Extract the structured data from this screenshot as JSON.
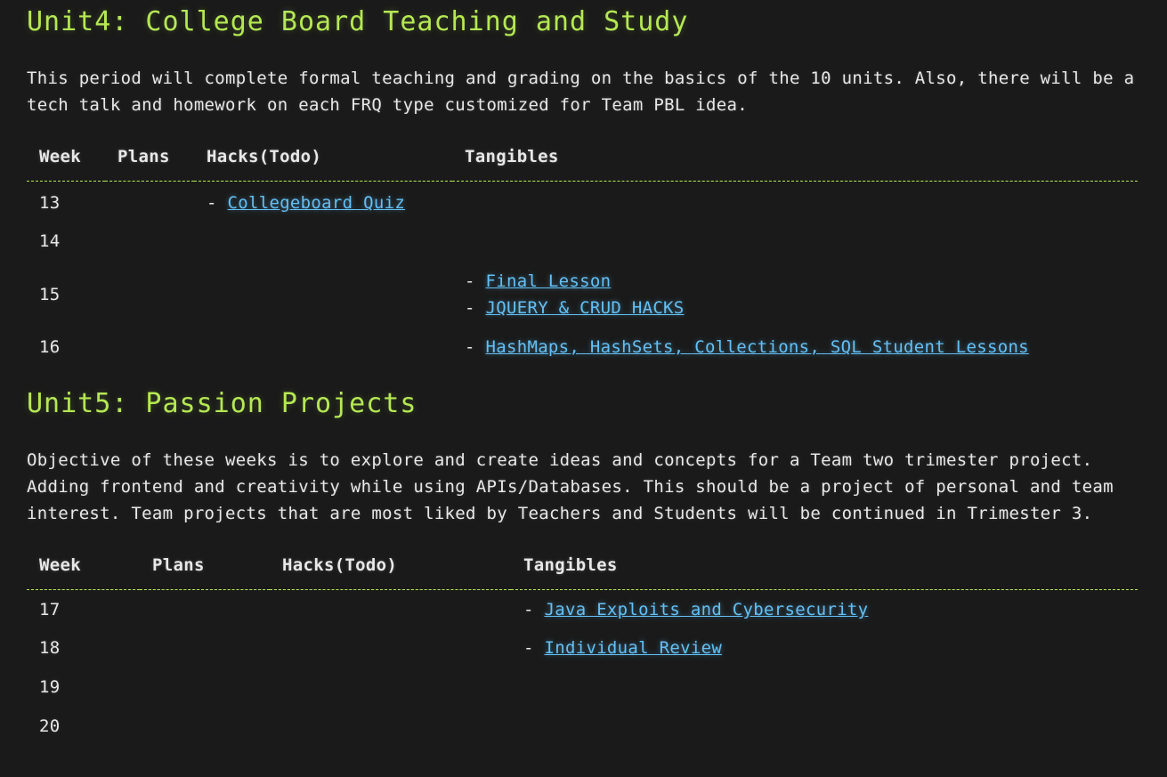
{
  "unit4": {
    "title": "Unit4: College Board Teaching and Study",
    "description": "This period will complete formal teaching and grading on the basics of the 10 units. Also, there will be a tech talk and homework on each FRQ type customized for Team PBL idea.",
    "headers": {
      "week": "Week",
      "plans": "Plans",
      "hacks": "Hacks(Todo)",
      "tangibles": "Tangibles"
    },
    "rows": [
      {
        "week": "13",
        "hacks": [
          {
            "dash": "-",
            "link": "Collegeboard Quiz"
          }
        ],
        "tangibles": []
      },
      {
        "week": "14",
        "hacks": [],
        "tangibles": []
      },
      {
        "week": "15",
        "hacks": [],
        "tangibles": [
          {
            "dash": "-",
            "link": "Final Lesson"
          },
          {
            "dash": "-",
            "link": "JQUERY & CRUD HACKS"
          }
        ]
      },
      {
        "week": "16",
        "hacks": [],
        "tangibles": [
          {
            "dash": "-",
            "link": "HashMaps, HashSets, Collections, SQL Student Lessons"
          }
        ]
      }
    ]
  },
  "unit5": {
    "title": "Unit5: Passion Projects",
    "description": "Objective of these weeks is to explore and create ideas and concepts for a Team two trimester project. Adding frontend and creativity while using APIs/Databases. This should be a project of personal and team interest. Team projects that are most liked by Teachers and Students will be continued in Trimester 3.",
    "headers": {
      "week": "Week",
      "plans": "Plans",
      "hacks": "Hacks(Todo)",
      "tangibles": "Tangibles"
    },
    "rows": [
      {
        "week": "17",
        "tangibles": [
          {
            "dash": "-",
            "link": "Java Exploits and Cybersecurity"
          }
        ]
      },
      {
        "week": "18",
        "tangibles": [
          {
            "dash": "-",
            "link": "Individual Review"
          }
        ]
      },
      {
        "week": "19",
        "tangibles": []
      },
      {
        "week": "20",
        "tangibles": []
      }
    ]
  },
  "colors": {
    "background": "#1a1a1a",
    "heading": "#b5e853",
    "text": "#e8e8e8",
    "link": "#63c0f5"
  }
}
